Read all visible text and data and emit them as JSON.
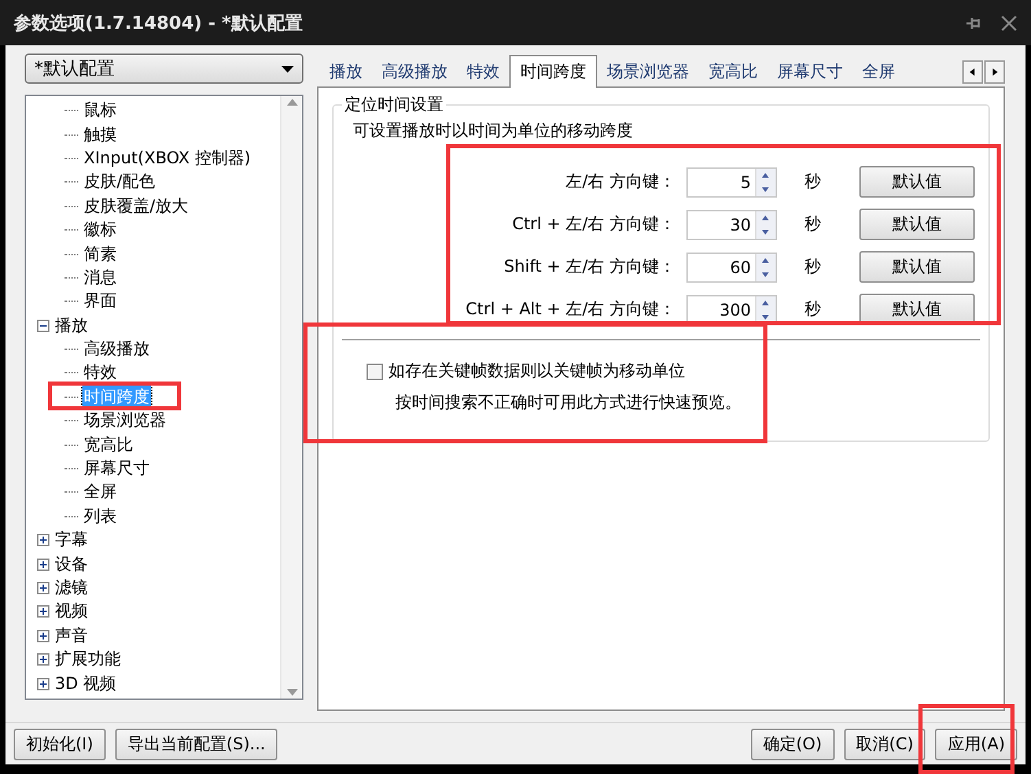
{
  "window": {
    "title": "参数选项(1.7.14804) - *默认配置"
  },
  "profile_select": {
    "value": "*默认配置"
  },
  "tree": {
    "items": [
      {
        "children": [
          {
            "label": "鼠标",
            "selected": false
          },
          {
            "label": "触摸",
            "selected": false
          },
          {
            "label": "XInput(XBOX 控制器)",
            "selected": false
          },
          {
            "label": "皮肤/配色",
            "selected": false
          },
          {
            "label": "皮肤覆盖/放大",
            "selected": false
          },
          {
            "label": "徽标",
            "selected": false
          },
          {
            "label": "简素",
            "selected": false
          },
          {
            "label": "消息",
            "selected": false
          },
          {
            "label": "界面",
            "selected": false
          }
        ]
      },
      {
        "label": "播放",
        "expanded": true,
        "selected": false,
        "children": [
          {
            "label": "高级播放",
            "selected": false
          },
          {
            "label": "特效",
            "selected": false
          },
          {
            "label": "时间跨度",
            "selected": true
          },
          {
            "label": "场景浏览器",
            "selected": false
          },
          {
            "label": "宽高比",
            "selected": false
          },
          {
            "label": "屏幕尺寸",
            "selected": false
          },
          {
            "label": "全屏",
            "selected": false
          },
          {
            "label": "列表",
            "selected": false
          }
        ]
      },
      {
        "label": "字幕",
        "expanded": false,
        "selected": false
      },
      {
        "label": "设备",
        "expanded": false,
        "selected": false
      },
      {
        "label": "滤镜",
        "expanded": false,
        "selected": false
      },
      {
        "label": "视频",
        "expanded": false,
        "selected": false
      },
      {
        "label": "声音",
        "expanded": false,
        "selected": false
      },
      {
        "label": "扩展功能",
        "expanded": false,
        "selected": false
      },
      {
        "label": "3D 视频",
        "expanded": false,
        "selected": false
      }
    ]
  },
  "tabs": [
    {
      "label": "播放",
      "selected": false
    },
    {
      "label": "高级播放",
      "selected": false
    },
    {
      "label": "特效",
      "selected": false
    },
    {
      "label": "时间跨度",
      "selected": true
    },
    {
      "label": "场景浏览器",
      "selected": false
    },
    {
      "label": "宽高比",
      "selected": false
    },
    {
      "label": "屏幕尺寸",
      "selected": false
    },
    {
      "label": "全屏",
      "selected": false
    }
  ],
  "group": {
    "title": "定位时间设置",
    "description": "可设置播放时以时间为单位的移动跨度",
    "rows": [
      {
        "label": "左/右 方向键：",
        "value": "5",
        "unit": "秒",
        "button": "默认值"
      },
      {
        "label": "Ctrl + 左/右 方向键：",
        "value": "30",
        "unit": "秒",
        "button": "默认值"
      },
      {
        "label": "Shift + 左/右 方向键：",
        "value": "60",
        "unit": "秒",
        "button": "默认值"
      },
      {
        "label": "Ctrl + Alt + 左/右 方向键：",
        "value": "300",
        "unit": "秒",
        "button": "默认值"
      }
    ],
    "keyframe_option": {
      "label": "如存在关键帧数据则以关键帧为移动单位",
      "checked": false,
      "note": "按时间搜索不正确时可用此方式进行快速预览。"
    }
  },
  "buttons_left": [
    "初始化(I)",
    "导出当前配置(S)..."
  ],
  "buttons_right": [
    "确定(O)",
    "取消(C)",
    "应用(A)"
  ]
}
